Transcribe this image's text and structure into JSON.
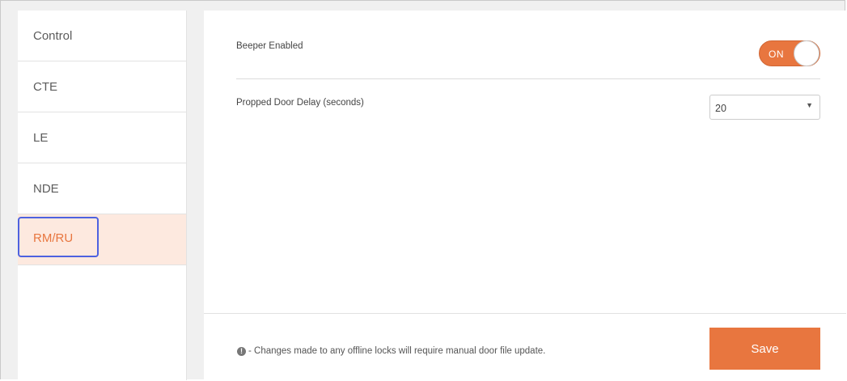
{
  "sidebar": {
    "items": [
      {
        "label": "Control"
      },
      {
        "label": "CTE"
      },
      {
        "label": "LE"
      },
      {
        "label": "NDE"
      },
      {
        "label": "RM/RU",
        "active": true
      }
    ]
  },
  "settings": {
    "beeper": {
      "label": "Beeper Enabled",
      "toggle_text": "ON",
      "enabled": true
    },
    "propped_door": {
      "label": "Propped Door Delay (seconds)",
      "value": "20"
    }
  },
  "footer": {
    "info_icon": "info-circle-icon",
    "notice": "- Changes made to any offline locks will require manual door file update.",
    "save_label": "Save"
  },
  "colors": {
    "accent": "#e8763f",
    "active_bg": "#fde9df",
    "focus_ring": "#4d62e0"
  }
}
